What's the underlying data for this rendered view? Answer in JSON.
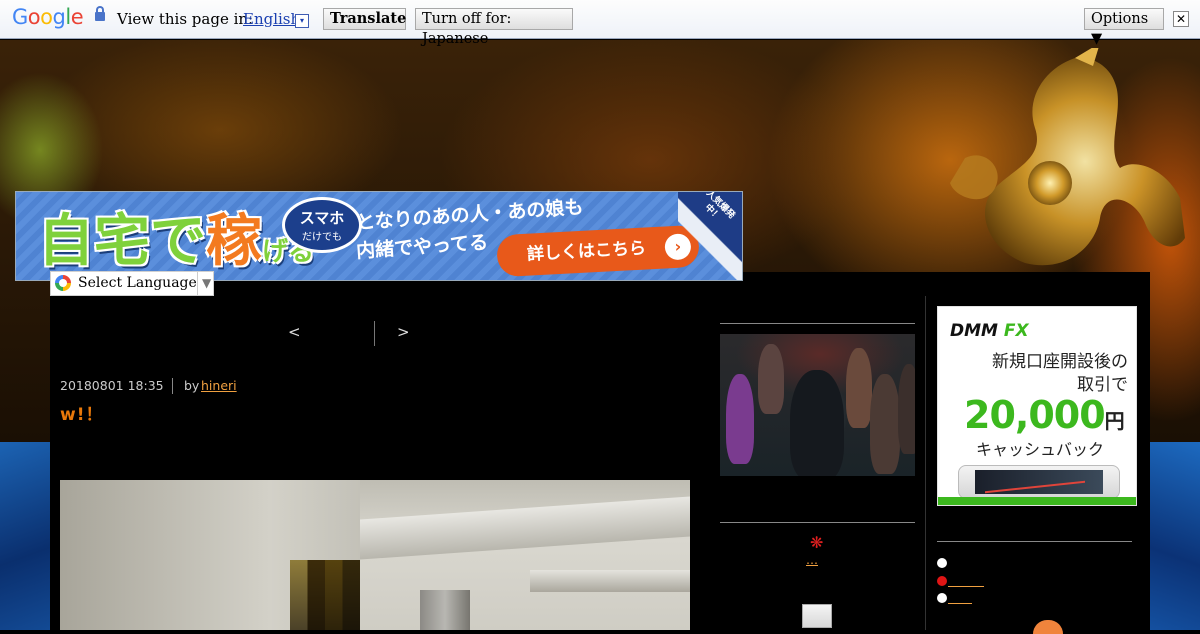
{
  "translate_bar": {
    "logo": {
      "G": "G",
      "o1": "o",
      "o2": "o",
      "g": "g",
      "l": "l",
      "e": "e"
    },
    "view_text": "View this page in:",
    "language": "English",
    "language_drop": "▾",
    "translate_button": "Translate",
    "turn_off_button": "Turn off for: Japanese",
    "options_button": "Options ▼",
    "close_button": "✕"
  },
  "ad_banner": {
    "kanji_1": "自宅で",
    "kanji_2": "稼",
    "kanji_3": "げる",
    "bubble_title": "スマホ",
    "bubble_sub": "だけでも",
    "line1": "となりのあの人・あの娘も",
    "line2": "内緒でやってる",
    "cta": "詳しくはこちら",
    "cta_arrow": "›",
    "corner_text": "人気爆発中！"
  },
  "select_language": {
    "label": "Select Language",
    "caret": "▼"
  },
  "post_nav": {
    "prev": "<",
    "next": ">"
  },
  "post": {
    "date": "20180801 18:35",
    "by": "by",
    "author": "hineri",
    "title": "w!！"
  },
  "middle_sidebar": {
    "star": "❋",
    "link_text": "…"
  },
  "dmm_ad": {
    "logo_dmm": "DMM",
    "logo_fx": "FX",
    "copy_line1": "新規口座開設後の",
    "copy_line2": "取引で",
    "amount": "20,000",
    "yen": "円",
    "cash": "キャッシュバック",
    "accent_color": "#3cb81e"
  },
  "right_sidebar": {
    "items": [
      {
        "dot": "white",
        "text": ""
      },
      {
        "dot": "red",
        "text": "＿＿＿"
      },
      {
        "dot": "white",
        "text": "＿＿"
      }
    ]
  },
  "colors": {
    "accent": "#e8780a",
    "link": "#f0a040",
    "star": "#e02020"
  }
}
